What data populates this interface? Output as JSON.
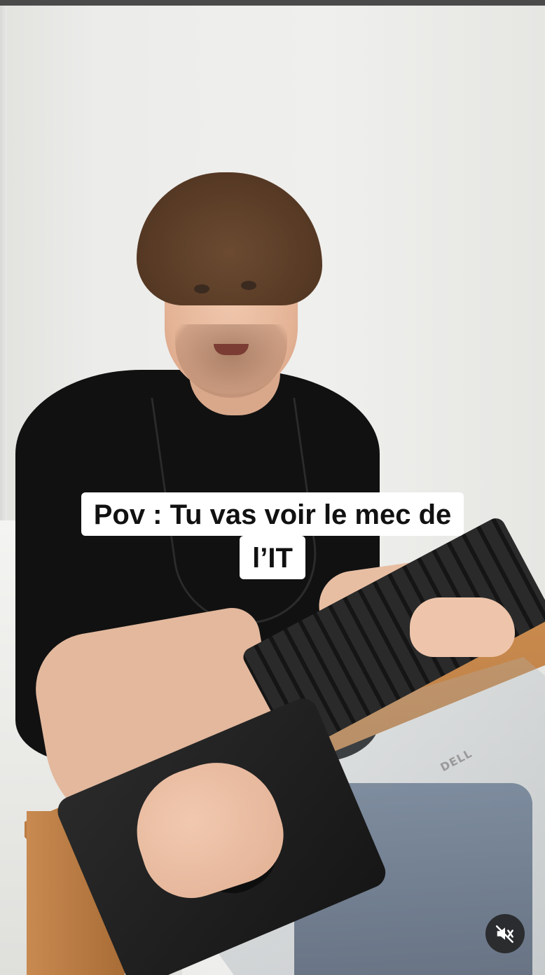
{
  "caption": {
    "line1": "Pov : Tu vas voir le mec de",
    "line2": "l’IT"
  },
  "keyboard": {
    "brand": "DELL"
  },
  "controls": {
    "mute_icon": "speaker-muted-icon",
    "mute_state": "muted"
  },
  "colors": {
    "caption_background": "#ffffff",
    "caption_text": "#111111",
    "mute_button_bg": "#1e1e1e"
  }
}
